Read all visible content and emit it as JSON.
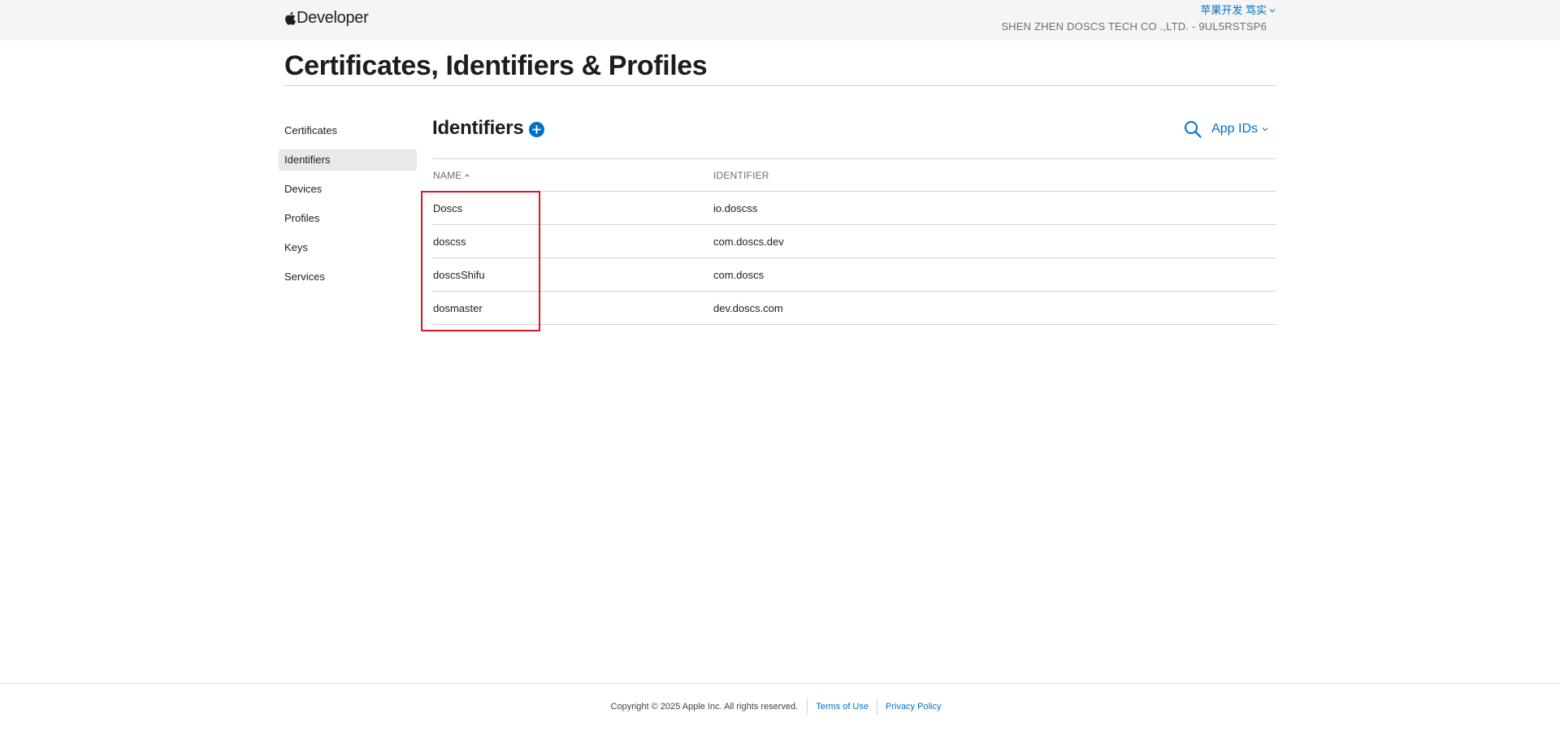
{
  "header": {
    "brand": "Developer",
    "account_name": "苹果开发 笃实",
    "team": "SHEN ZHEN DOSCS TECH CO .,LTD. - 9UL5RSTSP6"
  },
  "page": {
    "title": "Certificates, Identifiers & Profiles"
  },
  "sidebar": {
    "items": [
      {
        "label": "Certificates",
        "active": false
      },
      {
        "label": "Identifiers",
        "active": true
      },
      {
        "label": "Devices",
        "active": false
      },
      {
        "label": "Profiles",
        "active": false
      },
      {
        "label": "Keys",
        "active": false
      },
      {
        "label": "Services",
        "active": false
      }
    ]
  },
  "main": {
    "section_title": "Identifiers",
    "filter_label": "App IDs",
    "columns": {
      "name": "NAME",
      "identifier": "IDENTIFIER"
    },
    "rows": [
      {
        "name": "Doscs",
        "identifier": "io.doscss"
      },
      {
        "name": "doscss",
        "identifier": "com.doscs.dev"
      },
      {
        "name": "doscsShifu",
        "identifier": "com.doscs"
      },
      {
        "name": "dosmaster",
        "identifier": "dev.doscs.com"
      }
    ]
  },
  "footer": {
    "copyright": "Copyright © 2025 Apple Inc. All rights reserved.",
    "terms": "Terms of Use",
    "privacy": "Privacy Policy"
  },
  "colors": {
    "link": "#0070c9",
    "annotation": "#e0151f",
    "header_bg": "#f5f5f7",
    "active_item_bg": "#e8e8ed"
  }
}
